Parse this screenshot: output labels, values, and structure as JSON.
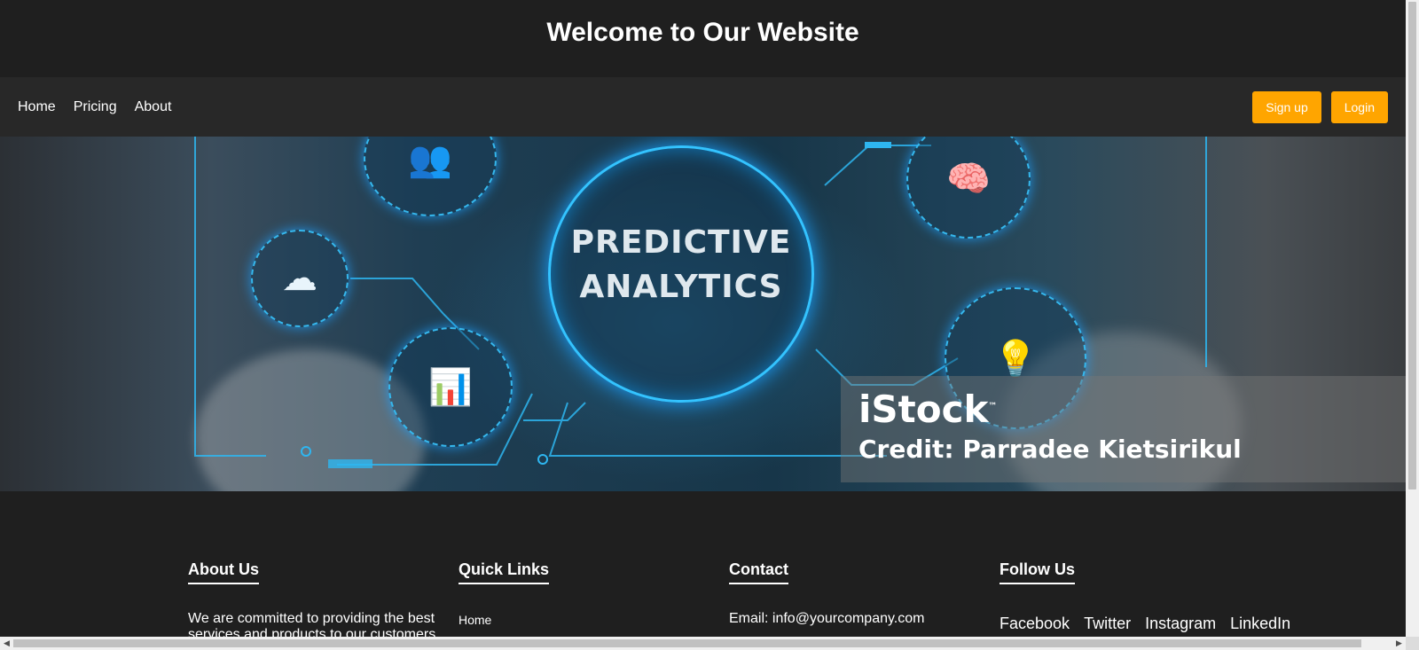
{
  "header": {
    "title": "Welcome to Our Website"
  },
  "nav": {
    "links": [
      "Home",
      "Pricing",
      "About"
    ],
    "signup_label": "Sign up",
    "login_label": "Login",
    "accent_color": "#ffa500"
  },
  "hero": {
    "title_line1": "PREDICTIVE",
    "title_line2": "ANALYTICS",
    "watermark": "iStock",
    "trademark": "™",
    "credit": "Credit: Parradee Kietsirikul",
    "icons": [
      "users-search-icon",
      "ai-head-icon",
      "cloud-server-icon",
      "chart-search-icon",
      "lightbulb-chart-icon"
    ]
  },
  "footer": {
    "about": {
      "heading": "About Us",
      "text": "We are committed to providing the best services and products to our customers."
    },
    "quick_links": {
      "heading": "Quick Links",
      "items": [
        "Home"
      ]
    },
    "contact": {
      "heading": "Contact",
      "email": "Email: info@yourcompany.com"
    },
    "follow": {
      "heading": "Follow Us",
      "items": [
        "Facebook",
        "Twitter",
        "Instagram",
        "LinkedIn"
      ]
    }
  }
}
